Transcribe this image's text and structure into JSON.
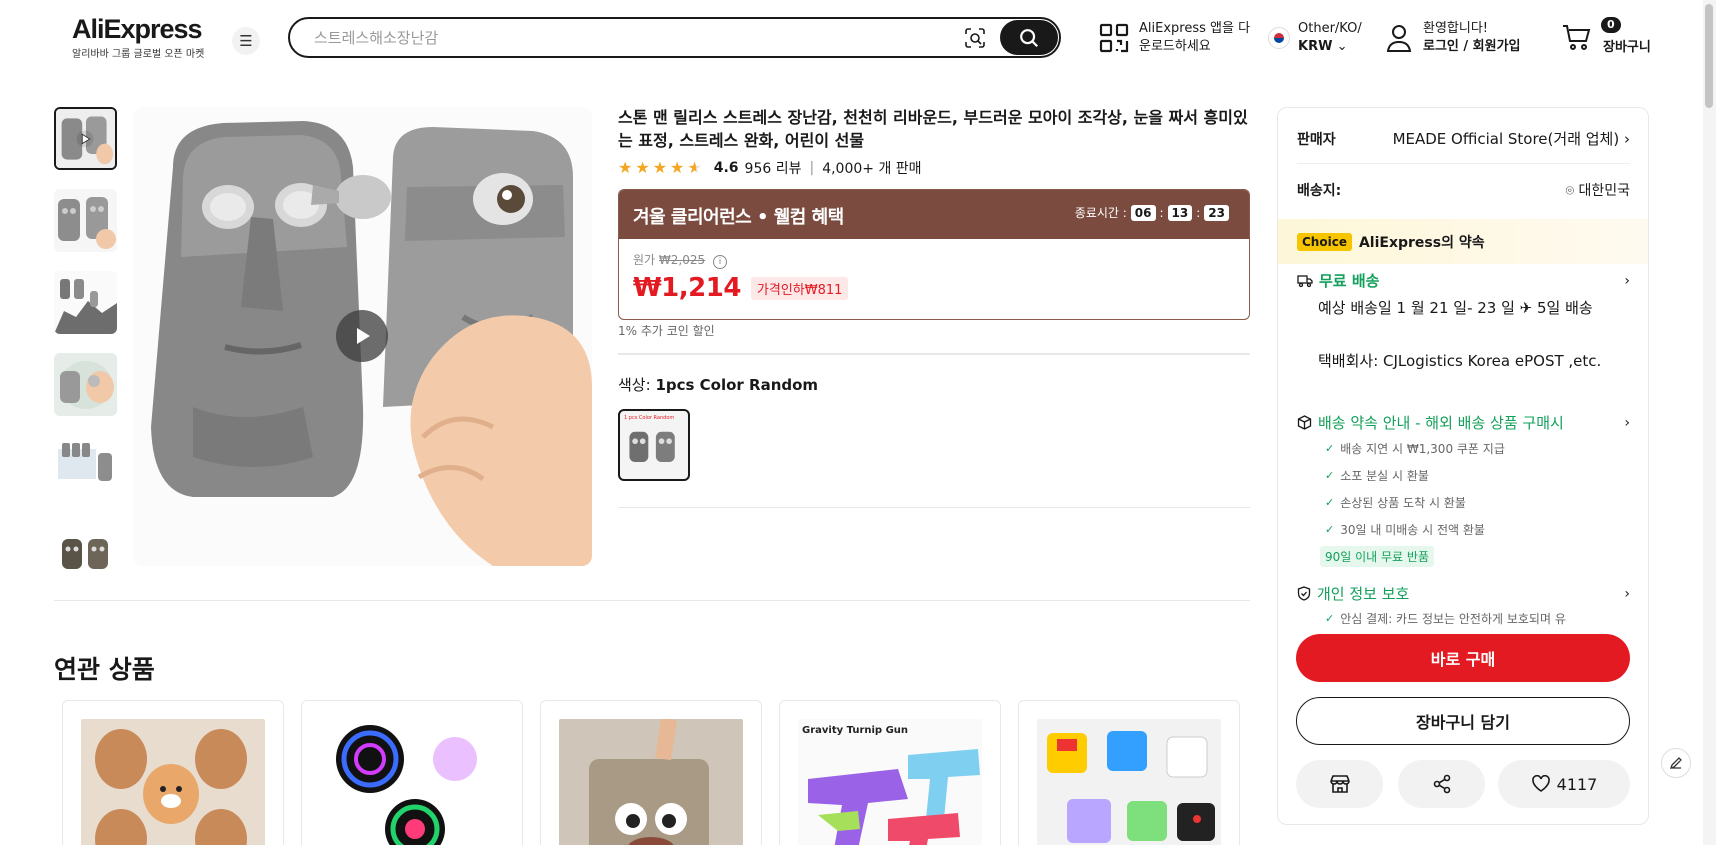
{
  "header": {
    "logo": "AliExpress",
    "logo_sub": "알리바바 그룹 글로벌 오픈 마켓",
    "search_placeholder": "스트레스해소장난감",
    "app_download": "AliExpress 앱을 다운로드하세요",
    "region_line1": "Other/KO/",
    "currency": "KRW",
    "welcome": "환영합니다!",
    "login": "로그인 / 회원가입",
    "cart_count": "0",
    "cart_label": "장바구니"
  },
  "product": {
    "title": "스톤 맨 릴리스 스트레스 장난감, 천천히 리바운드, 부드러운 모아이 조각상, 눈을 짜서 흥미있는 표정, 스트레스 완화, 어린이 선물",
    "rating": "4.6",
    "rating_value": 4.6,
    "reviews": "956 리뷰",
    "sold": "4,000+ 개 판매",
    "promo_title": "겨울 클리어런스 • 웰컴 혜택",
    "timer_label": "종료시간 :",
    "timer_h": "06",
    "timer_m": "13",
    "timer_s": "23",
    "orig_label": "원가",
    "orig_price": "₩2,025",
    "price": "₩1,214",
    "discount": "가격인하₩811",
    "coin": "1% 추가 코인 할인",
    "color_label": "색상:",
    "color_value": "1pcs Color Random",
    "swatch_text": "1 pcs  Color Random"
  },
  "related": {
    "title": "연관 상품",
    "card4_text": "Gravity Turnip Gun"
  },
  "panel": {
    "seller_label": "판매자",
    "seller_value": "MEADE Official Store(거래 업체)",
    "ship_to_label": "배송지:",
    "ship_to_value": "대한민국",
    "choice_tag": "Choice",
    "choice_text": "AliExpress의 약속",
    "free_shipping": "무료 배송",
    "delivery_text": "예상 배송일 1 월 21 일- 23 일 ✈ 5일 배송",
    "carrier_text": "택배회사:  CJLogistics  Korea ePOST ,etc.",
    "promise_head": "배송 약속 안내 - 해외 배송 상품 구매시",
    "promise_items": [
      "배송 지연 시 ₩1,300 쿠폰 지급",
      "소포 분실 시 환불",
      "손상된 상품 도착 시 환불",
      "30일 내 미배송 시 전액 환불"
    ],
    "free_return": "90일 이내 무료 반품",
    "privacy_head": "개인 정보 보호",
    "privacy_item": "안심 결제: 카드 정보는 안전하게 보호되며 유",
    "buy_now": "바로 구매",
    "add_cart": "장바구니 담기",
    "wish_count": "4117"
  }
}
